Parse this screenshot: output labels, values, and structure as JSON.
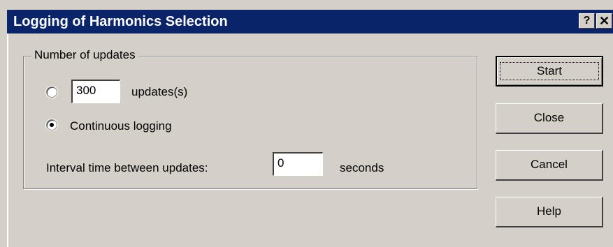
{
  "window": {
    "title": "Logging of Harmonics Selection",
    "help_glyph": "?",
    "close_glyph": "✕"
  },
  "group": {
    "label": "Number of updates",
    "count_value": "300",
    "count_unit": "updates(s)",
    "count_selected": false,
    "continuous_label": "Continuous logging",
    "continuous_selected": true,
    "interval_label": "Interval time between updates:",
    "interval_value": "0",
    "interval_unit": "seconds"
  },
  "buttons": {
    "start": "Start",
    "close": "Close",
    "cancel": "Cancel",
    "help": "Help"
  },
  "colors": {
    "titlebar": "#0a246a",
    "face": "#d4d0c8"
  }
}
